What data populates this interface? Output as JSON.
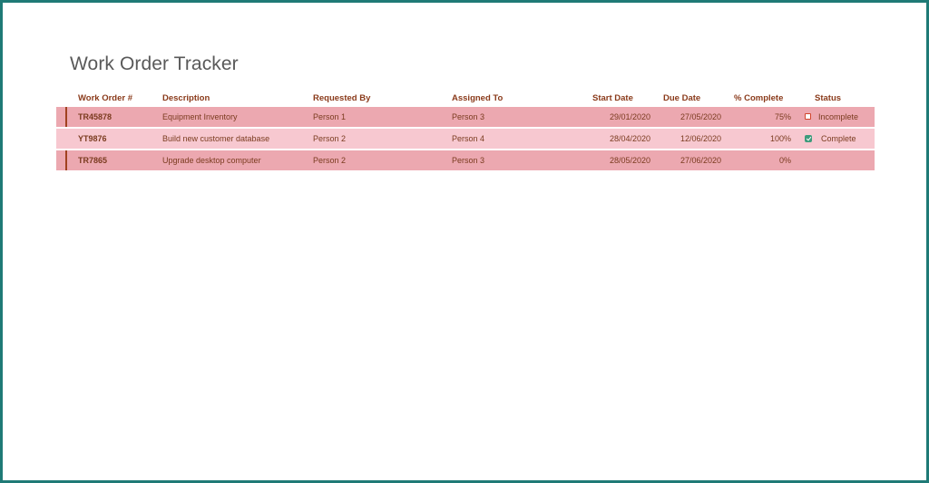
{
  "title": "Work Order Tracker",
  "columns": {
    "work_order": "Work Order #",
    "description": "Description",
    "requested_by": "Requested By",
    "assigned_to": "Assigned To",
    "start_date": "Start Date",
    "due_date": "Due Date",
    "percent_complete": "% Complete",
    "status": "Status"
  },
  "rows": [
    {
      "work_order": "TR45878",
      "description": "Equipment Inventory",
      "requested_by": "Person 1",
      "assigned_to": "Person 3",
      "start_date": "29/01/2020",
      "due_date": "27/05/2020",
      "percent_complete": "75%",
      "status": "Incomplete",
      "status_icon": "incomplete-icon"
    },
    {
      "work_order": "YT9876",
      "description": "Build new customer database",
      "requested_by": "Person 2",
      "assigned_to": "Person 4",
      "start_date": "28/04/2020",
      "due_date": "12/06/2020",
      "percent_complete": "100%",
      "status": "Complete",
      "status_icon": "complete-icon"
    },
    {
      "work_order": "TR7865",
      "description": "Upgrade desktop computer",
      "requested_by": "Person 2",
      "assigned_to": "Person 3",
      "start_date": "28/05/2020",
      "due_date": "27/06/2020",
      "percent_complete": "0%",
      "status": "",
      "status_icon": ""
    }
  ],
  "colors": {
    "frame_border": "#1f7a76",
    "header_text": "#8a3a1a",
    "row_odd": "#eca8b0",
    "row_even": "#f7c8d0",
    "incomplete": "#d0442b",
    "complete": "#3e9b7c"
  }
}
